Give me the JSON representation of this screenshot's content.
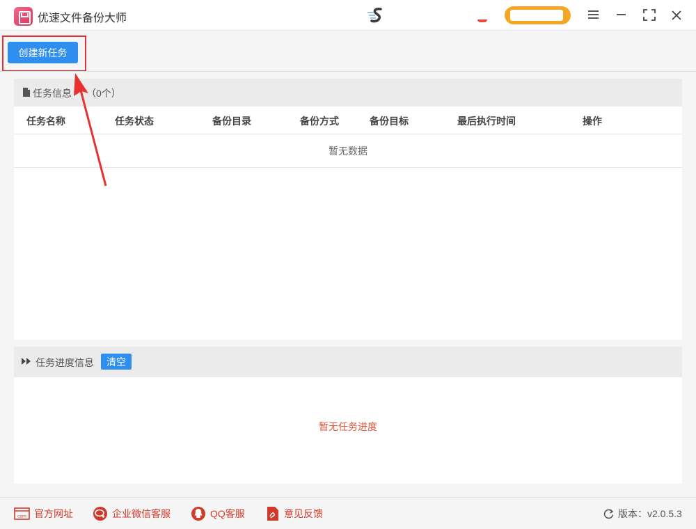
{
  "window": {
    "title": "优速文件备份大师"
  },
  "toolbar": {
    "create_task_label": "创建新任务"
  },
  "task_info": {
    "header_label": "任务信息",
    "count_label": "（0个）",
    "columns": [
      {
        "label": "任务名称"
      },
      {
        "label": "任务状态"
      },
      {
        "label": "备份目录"
      },
      {
        "label": "备份方式"
      },
      {
        "label": "备份目标"
      },
      {
        "label": "最后执行时间"
      },
      {
        "label": "操作"
      }
    ],
    "empty_text": "暂无数据"
  },
  "progress_info": {
    "header_label": "任务进度信息",
    "clear_label": "清空",
    "empty_text": "暂无任务进度"
  },
  "footer": {
    "links": [
      {
        "label": "官方网址",
        "icon": "website-icon"
      },
      {
        "label": "企业微信客服",
        "icon": "wechat-work-icon"
      },
      {
        "label": "QQ客服",
        "icon": "qq-icon"
      },
      {
        "label": "意见反馈",
        "icon": "feedback-icon"
      }
    ],
    "version_label": "版本：v2.0.5.3"
  },
  "colors": {
    "accent_blue": "#2f8ff0",
    "annotation_red": "#e83030",
    "footer_link_red": "#d03a2c",
    "empty_progress_orange": "#e0553a"
  }
}
